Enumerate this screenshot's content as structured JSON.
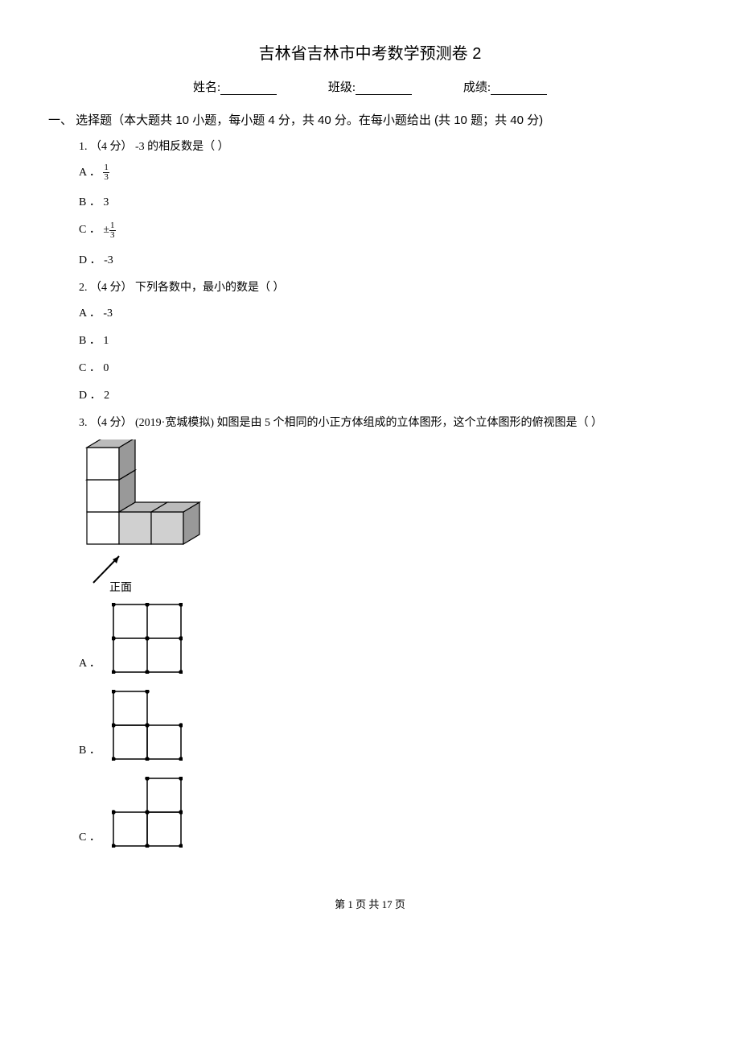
{
  "title": "吉林省吉林市中考数学预测卷 2",
  "info": {
    "name_label": "姓名:",
    "class_label": "班级:",
    "score_label": "成绩:"
  },
  "section1": {
    "header": "一、 选择题（本大题共 10 小题，每小题 4 分，共 40 分。在每小题给出 (共 10 题；共 40 分)"
  },
  "q1": {
    "stem": "1. （4 分） -3 的相反数是（    ）",
    "optA_label": "A ．",
    "optA_num": "1",
    "optA_den": "3",
    "optB": "B ． 3",
    "optC_label": "C ．",
    "optC_prefix": "±",
    "optC_num": "1",
    "optC_den": "3",
    "optD": "D ． -3"
  },
  "q2": {
    "stem": "2. （4 分） 下列各数中，最小的数是（    ）",
    "optA": "A ． -3",
    "optB": "B ． 1",
    "optC": "C ． 0",
    "optD": "D ． 2"
  },
  "q3": {
    "stem": "3. （4 分） (2019·宽城模拟) 如图是由 5 个相同的小正方体组成的立体图形，这个立体图形的俯视图是（    ）",
    "front_label": "正面",
    "optA": "A ．",
    "optB": "B ．",
    "optC": "C ．"
  },
  "footer": {
    "page_prefix": "第 ",
    "page_num": "1",
    "page_mid": " 页 共 ",
    "page_total": "17",
    "page_suffix": " 页"
  }
}
